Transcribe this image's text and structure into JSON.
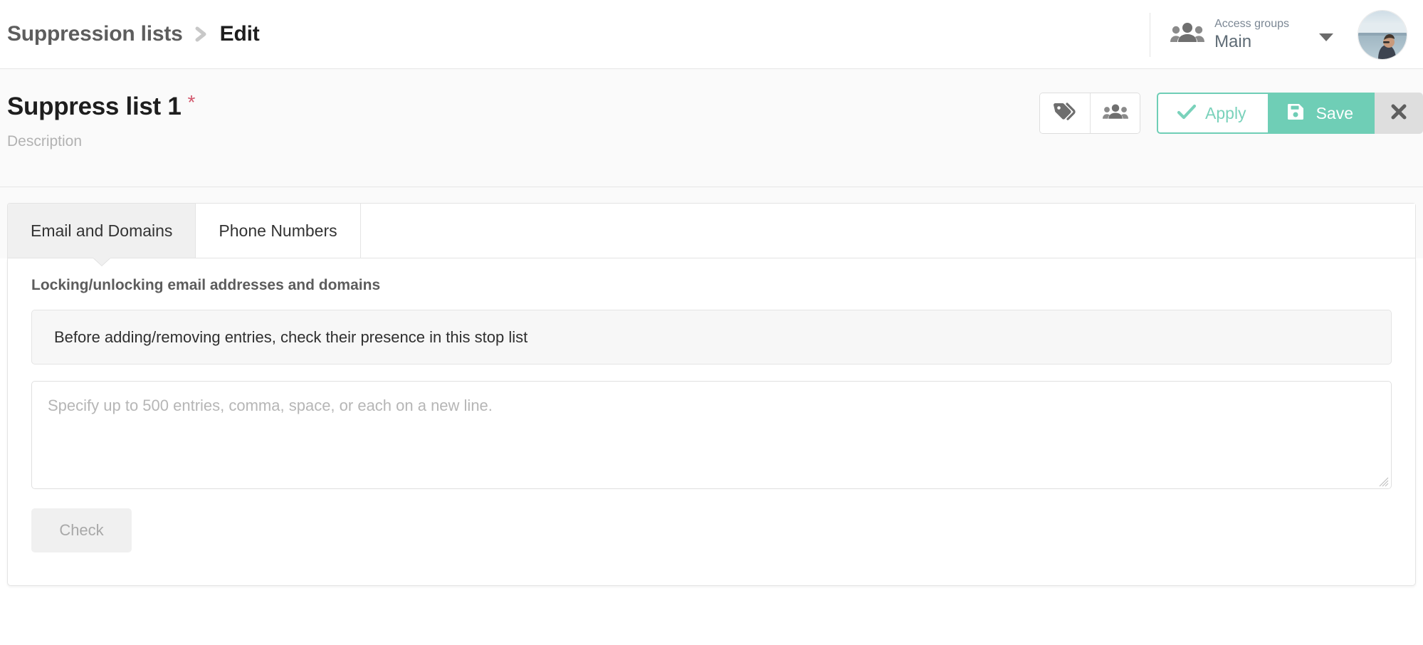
{
  "topbar": {
    "breadcrumb": {
      "root": "Suppression lists",
      "separator_icon": "chevron-right-icon",
      "current": "Edit"
    },
    "access_groups": {
      "icon": "users-group-icon",
      "label": "Access groups",
      "value": "Main",
      "caret_icon": "chevron-down-icon"
    },
    "avatar_alt": "user-avatar"
  },
  "header": {
    "title": "Suppress list 1",
    "required_marker": "*",
    "description_placeholder": "Description",
    "description_value": "",
    "icon_buttons": [
      {
        "name": "tags-icon",
        "tooltip": "Tags"
      },
      {
        "name": "users-group-icon",
        "tooltip": "Access groups"
      }
    ],
    "apply_label": "Apply",
    "apply_icon": "check-icon",
    "save_label": "Save",
    "save_icon": "floppy-disk-icon",
    "close_icon": "close-icon"
  },
  "tabs": [
    {
      "label": "Email and Domains",
      "active": true
    },
    {
      "label": "Phone Numbers",
      "active": false
    }
  ],
  "content": {
    "section_title": "Locking/unlocking email addresses and domains",
    "info_banner": "Before adding/removing entries, check their presence in this stop list",
    "entries_placeholder": "Specify up to 500 entries, comma, space, or each on a new line.",
    "entries_value": "",
    "check_label": "Check"
  },
  "colors": {
    "accent_teal": "#6fceb6",
    "apply_text": "#7ad2bb",
    "required_star": "#d3596e",
    "page_bg": "#ffffff",
    "header_bg": "#fafafa",
    "close_btn_bg": "#dedede",
    "disabled_btn_bg": "#f0f0f0"
  }
}
